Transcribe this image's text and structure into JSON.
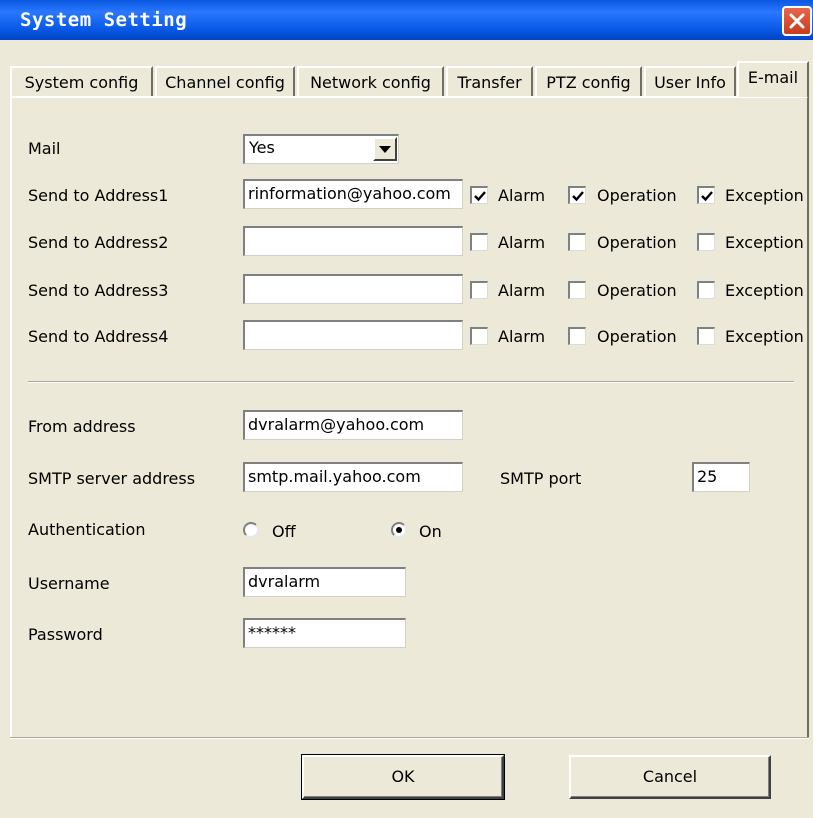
{
  "window": {
    "title": "System Setting",
    "accent": "#0a5be8",
    "close_color": "#d84a2a"
  },
  "tabs": [
    {
      "label": "System config"
    },
    {
      "label": "Channel config"
    },
    {
      "label": "Network config"
    },
    {
      "label": "Transfer"
    },
    {
      "label": "PTZ config"
    },
    {
      "label": "User Info"
    },
    {
      "label": "E-mail",
      "active": true
    }
  ],
  "mail": {
    "label": "Mail",
    "value": "Yes"
  },
  "checkbox_labels": {
    "alarm": "Alarm",
    "operation": "Operation",
    "exception": "Exception"
  },
  "addresses": [
    {
      "label": "Send to Address1",
      "value": "rinformation@yahoo.com",
      "alarm": true,
      "operation": true,
      "exception": true
    },
    {
      "label": "Send to Address2",
      "value": "",
      "alarm": false,
      "operation": false,
      "exception": false
    },
    {
      "label": "Send to Address3",
      "value": "",
      "alarm": false,
      "operation": false,
      "exception": false
    },
    {
      "label": "Send to Address4",
      "value": "",
      "alarm": false,
      "operation": false,
      "exception": false
    }
  ],
  "from": {
    "label": "From address",
    "value": "dvralarm@yahoo.com"
  },
  "smtp": {
    "label": "SMTP server address",
    "value": "smtp.mail.yahoo.com",
    "port_label": "SMTP port",
    "port": "25"
  },
  "auth": {
    "label": "Authentication",
    "off_label": "Off",
    "on_label": "On",
    "selected": "On"
  },
  "username": {
    "label": "Username",
    "value": "dvralarm"
  },
  "password": {
    "label": "Password",
    "value": "******"
  },
  "buttons": {
    "ok": "OK",
    "cancel": "Cancel"
  }
}
